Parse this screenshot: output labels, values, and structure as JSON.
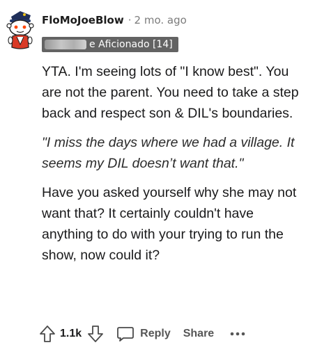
{
  "comment": {
    "username": "FloMoJoeBlow",
    "separator": "·",
    "timestamp": "2 mo. ago",
    "flair": "e Aficionado [14]",
    "paragraphs": [
      "YTA. I'm seeing lots of \"I know best\". You are not the parent. You need to take a step back and respect son & DIL's boundaries.",
      "\"I miss the days where we had a village. It seems my DIL doesn’t want that.\"",
      "Have you asked yourself why she may not want that? It certainly couldn't have anything to do with your trying to run the show, now could it?"
    ]
  },
  "actions": {
    "upvote_icon": "upvote-arrow-icon",
    "vote_count": "1.1k",
    "downvote_icon": "downvote-arrow-icon",
    "reply_icon": "speech-bubble-icon",
    "reply_label": "Reply",
    "share_label": "Share",
    "more_icon": "ellipsis-icon"
  },
  "colors": {
    "flair_bg": "#636363",
    "muted_text": "#7c7c7c",
    "action_text": "#565656"
  }
}
